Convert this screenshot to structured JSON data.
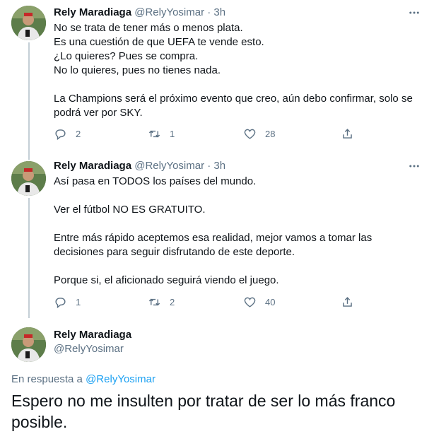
{
  "tweets": [
    {
      "name": "Rely Maradiaga",
      "meta": "@RelyYosimar · 3h",
      "paragraphs": [
        "No se trata de tener más o menos plata.\nEs una cuestión de que UEFA te vende esto.\n¿Lo quieres? Pues se compra.\nNo lo quieres, pues no tienes nada.",
        "La Champions será el próximo evento que creo, aún debo confirmar, solo se podrá ver por SKY."
      ],
      "replies": "2",
      "retweets": "1",
      "likes": "28"
    },
    {
      "name": "Rely Maradiaga",
      "meta": "@RelyYosimar · 3h",
      "paragraphs": [
        "Así pasa en TODOS los países del mundo.",
        "Ver el fútbol NO ES GRATUITO.",
        "Entre más rápido aceptemos esa realidad, mejor vamos a tomar las decisiones para seguir disfrutando de este deporte.",
        "Porque si, el aficionado seguirá viendo el juego."
      ],
      "replies": "1",
      "retweets": "2",
      "likes": "40"
    }
  ],
  "main_tweet": {
    "name": "Rely Maradiaga",
    "handle": "@RelyYosimar",
    "reply_prefix": "En respuesta a",
    "reply_mention": "@RelyYosimar",
    "text": "Espero no me insulten por tratar de ser lo más franco posible."
  },
  "icons": {
    "reply": "reply-icon",
    "retweet": "retweet-icon",
    "like": "heart-icon",
    "share": "share-icon",
    "more": "more-icon"
  },
  "colors": {
    "secondary_text": "#5b7083",
    "link": "#1da1f2",
    "divider": "#ebeef0"
  }
}
